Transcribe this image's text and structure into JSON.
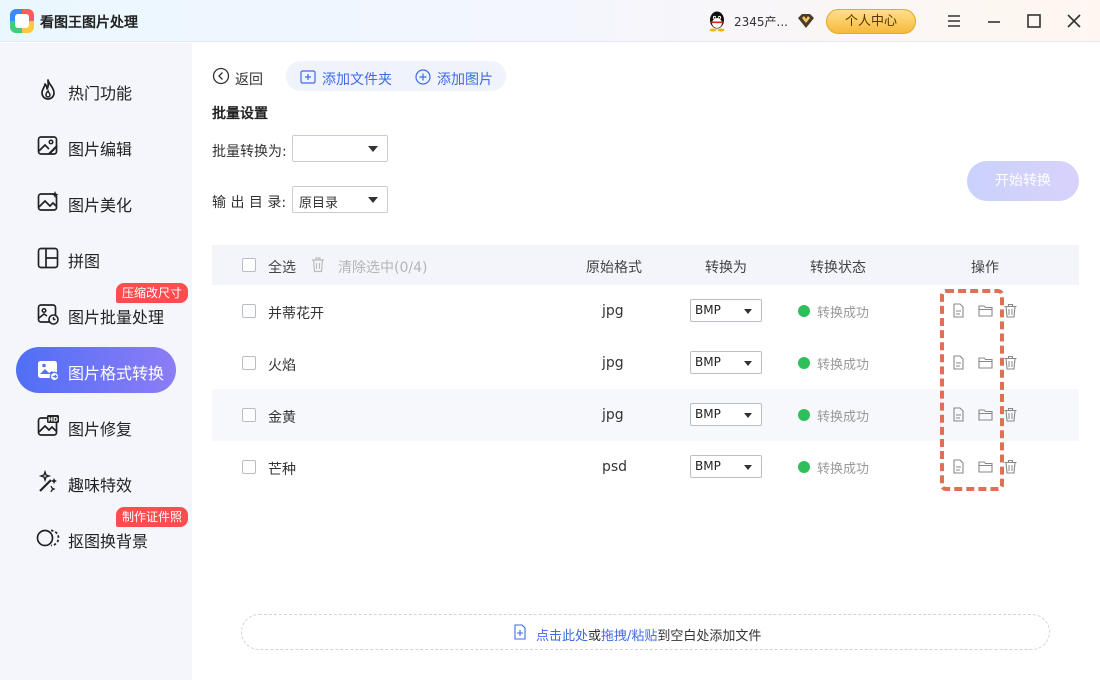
{
  "titlebar": {
    "app_title": "看图王图片处理",
    "account_name": "2345产...",
    "personal_center": "个人中心"
  },
  "sidebar": {
    "items": [
      {
        "label": "热门功能",
        "icon": "flame-icon"
      },
      {
        "label": "图片编辑",
        "icon": "image-edit-icon"
      },
      {
        "label": "图片美化",
        "icon": "image-sparkle-icon"
      },
      {
        "label": "拼图",
        "icon": "collage-icon"
      },
      {
        "label": "图片批量处理",
        "icon": "batch-image-icon",
        "badge": "压缩改尺寸"
      },
      {
        "label": "图片格式转换",
        "icon": "format-convert-icon",
        "active": true
      },
      {
        "label": "图片修复",
        "icon": "hd-image-icon"
      },
      {
        "label": "趣味特效",
        "icon": "magic-wand-icon"
      },
      {
        "label": "抠图换背景",
        "icon": "cutout-icon",
        "badge": "制作证件照"
      }
    ]
  },
  "toolbar": {
    "back": "返回",
    "add_folder": "添加文件夹",
    "add_image": "添加图片"
  },
  "batch": {
    "title": "批量设置",
    "convert_to_label": "批量转换为:",
    "convert_to_value": "",
    "output_dir_label": "输 出 目 录:",
    "output_dir_value": "原目录",
    "start_button": "开始转换"
  },
  "table": {
    "select_all": "全选",
    "clear_selected": "清除选中(0/4)",
    "headers": {
      "original_format": "原始格式",
      "convert_to": "转换为",
      "status": "转换状态",
      "actions": "操作"
    },
    "rows": [
      {
        "name": "并蒂花开",
        "format": "jpg",
        "target": "BMP",
        "status": "转换成功"
      },
      {
        "name": "火焰",
        "format": "jpg",
        "target": "BMP",
        "status": "转换成功"
      },
      {
        "name": "金黄",
        "format": "jpg",
        "target": "BMP",
        "status": "转换成功"
      },
      {
        "name": "芒种",
        "format": "psd",
        "target": "BMP",
        "status": "转换成功"
      }
    ]
  },
  "drop_zone": {
    "click_here": "点击此处",
    "or": "或",
    "drag_paste": "拖拽/粘贴",
    "suffix": "到空白处添加文件"
  },
  "colors": {
    "accent": "#3d6be8",
    "active_gradient_start": "#4f6ff5",
    "active_gradient_end": "#8d7cf6",
    "badge": "#ff4d4f",
    "success": "#2fbf5a",
    "highlight": "#e07055"
  }
}
